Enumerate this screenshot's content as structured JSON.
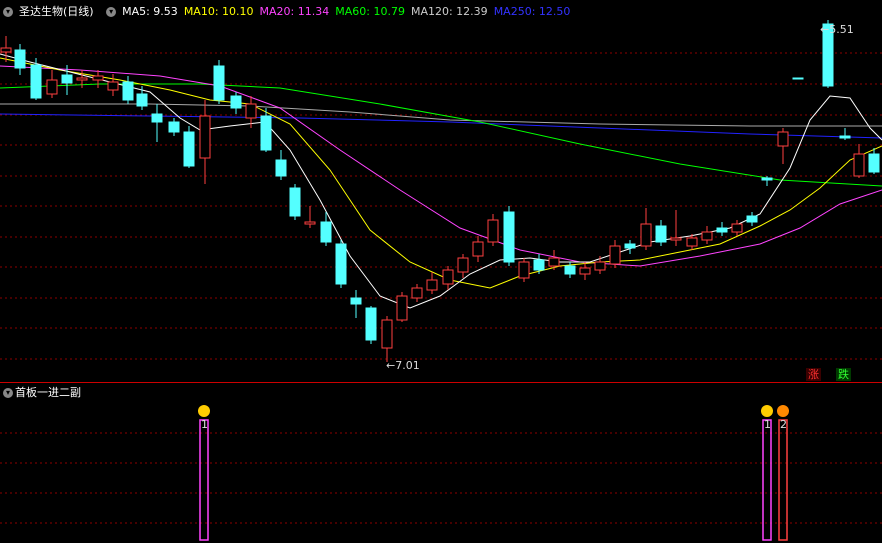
{
  "header": {
    "stock_name": "圣达生物(日线)",
    "ma_items": [
      {
        "label": "MA5: 9.53",
        "color": "#ffffff"
      },
      {
        "label": "MA10: 10.10",
        "color": "#ffff00"
      },
      {
        "label": "MA20: 11.34",
        "color": "#ff44ff"
      },
      {
        "label": "MA60: 10.79",
        "color": "#00ff00"
      },
      {
        "label": "MA120: 12.39",
        "color": "#cccccc"
      },
      {
        "label": "MA250: 12.50",
        "color": "#2222ff"
      }
    ]
  },
  "annotations": {
    "high_label": "5.51",
    "low_label": "7.01"
  },
  "badges": {
    "rise": "涨",
    "fall": "跌"
  },
  "indicator": {
    "title": "首板一进二副",
    "signals": [
      {
        "label": "1",
        "icon": "smile-icon"
      },
      {
        "label": "1",
        "icon": "smile-icon"
      },
      {
        "label": "2",
        "icon": "money-bag-icon"
      }
    ]
  },
  "colors": {
    "up": "#ff4040",
    "down": "#54ffff",
    "grid": "#8b0000",
    "separator": "#cc0000"
  }
}
